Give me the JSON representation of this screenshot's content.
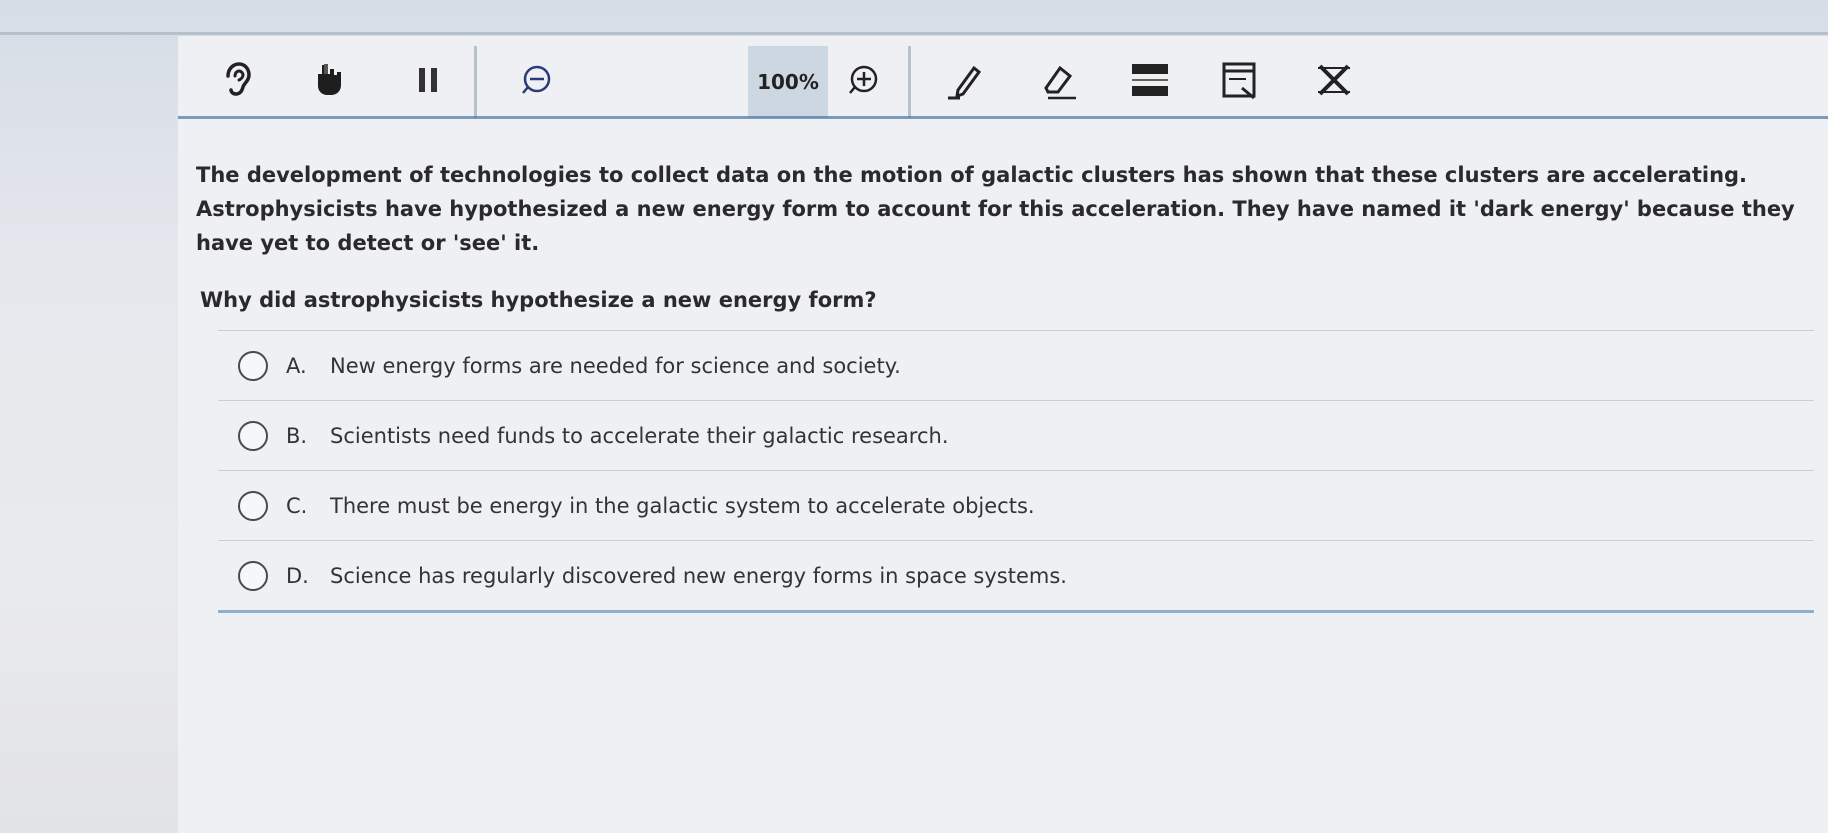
{
  "toolbar": {
    "zoom_level": "100%",
    "tools": [
      {
        "icon": "ear-icon"
      },
      {
        "icon": "hand-pointer-icon"
      },
      {
        "icon": "pause-icon"
      },
      {
        "icon": "zoom-out-icon"
      },
      {
        "icon": "zoom-in-icon"
      },
      {
        "icon": "highlighter-icon"
      },
      {
        "icon": "eraser-icon"
      },
      {
        "icon": "line-reader-icon"
      },
      {
        "icon": "notepad-icon"
      },
      {
        "icon": "answer-eliminator-icon"
      }
    ]
  },
  "passage": {
    "text": "The development of technologies to collect data on the motion of galactic clusters has shown that these clusters are accelerating. Astrophysicists have hypothesized a new energy form to account for this acceleration. They have named it 'dark energy' because they have yet to detect or 'see' it."
  },
  "question": {
    "text": "Why did astrophysicists hypothesize a new energy form?"
  },
  "choices": [
    {
      "letter": "A.",
      "text": "New energy forms are needed for science and society."
    },
    {
      "letter": "B.",
      "text": "Scientists need funds to accelerate their galactic research."
    },
    {
      "letter": "C.",
      "text": "There must be energy in the galactic system to accelerate objects."
    },
    {
      "letter": "D.",
      "text": "Science has regularly discovered new energy forms in space systems."
    }
  ]
}
